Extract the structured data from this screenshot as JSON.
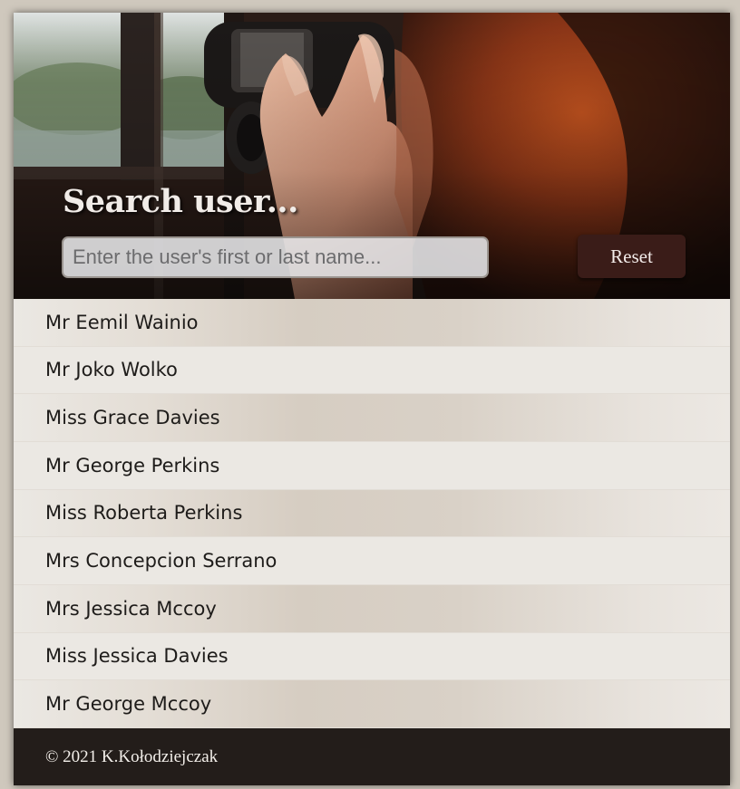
{
  "header": {
    "title": "Search user...",
    "search_placeholder": "Enter the user's first or last name...",
    "search_value": "",
    "reset_label": "Reset"
  },
  "users": [
    {
      "name": "Mr Eemil Wainio"
    },
    {
      "name": "Mr Joko Wolko"
    },
    {
      "name": "Miss Grace Davies"
    },
    {
      "name": "Mr George Perkins"
    },
    {
      "name": "Miss Roberta Perkins"
    },
    {
      "name": "Mrs Concepcion Serrano"
    },
    {
      "name": "Mrs Jessica Mccoy"
    },
    {
      "name": "Miss Jessica Davies"
    },
    {
      "name": "Mr George Mccoy"
    }
  ],
  "footer": {
    "copyright": "© 2021 K.Kołodziejczak"
  },
  "colors": {
    "footer_bg": "#231d1a",
    "reset_bg": "#3a1c18",
    "row_light": "#ebe8e3",
    "row_shade": "#d6cdc2"
  },
  "icons": {
    "hero_image": "woman-with-binoculars"
  }
}
